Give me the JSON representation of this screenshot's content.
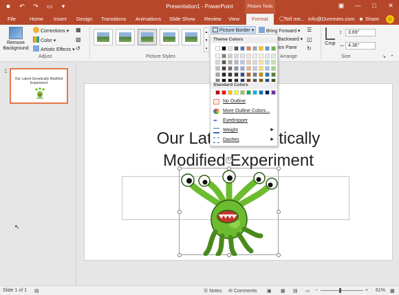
{
  "window": {
    "title": "Presentation1 - PowerPoint",
    "context_label": "Picture Tools"
  },
  "tabs": [
    "File",
    "Home",
    "Insert",
    "Design",
    "Transitions",
    "Animations",
    "Slide Show",
    "Review",
    "View",
    "Format"
  ],
  "active_tab": "Format",
  "tell_me": "Tell me...",
  "user": "info@Dummies.com",
  "share": "Share",
  "ribbon": {
    "remove_background": "Remove Background",
    "corrections": "Corrections",
    "color": "Color",
    "artistic_effects": "Artistic Effects",
    "adjust_label": "Adjust",
    "picture_styles_label": "Picture Styles",
    "picture_border": "Picture Border",
    "bring_forward": "Bring Forward",
    "backward": "Backward",
    "selection_pane": "ion Pane",
    "arrange_label": "Arrange",
    "crop": "Crop",
    "height": "3.69\"",
    "width": "4.36\"",
    "size_label": "Size"
  },
  "menu": {
    "theme_colors_label": "Theme Colors",
    "standard_colors_label": "Standard Colors",
    "theme_colors": [
      [
        "#ffffff",
        "#000000",
        "#e7e6e6",
        "#44546a",
        "#4472c4",
        "#ed7d31",
        "#a5a5a5",
        "#ffc000",
        "#5b9bd5",
        "#70ad47"
      ],
      [
        "#f2f2f2",
        "#7f7f7f",
        "#d0cece",
        "#d6dce4",
        "#d9e2f3",
        "#fbe4d5",
        "#ededed",
        "#fff2cc",
        "#deebf6",
        "#e2efd9"
      ],
      [
        "#d8d8d8",
        "#595959",
        "#aeabab",
        "#adb9ca",
        "#b4c6e7",
        "#f7caac",
        "#dbdbdb",
        "#fee599",
        "#bdd7ee",
        "#c5e0b3"
      ],
      [
        "#bfbfbf",
        "#3f3f3f",
        "#757070",
        "#8496b0",
        "#8eaadb",
        "#f4b183",
        "#c9c9c9",
        "#ffd965",
        "#9cc3e5",
        "#a8d08d"
      ],
      [
        "#a5a5a5",
        "#262626",
        "#3a3838",
        "#323f4f",
        "#2f5496",
        "#c55a11",
        "#7b7b7b",
        "#bf8f00",
        "#2e75b5",
        "#538135"
      ],
      [
        "#7f7f7f",
        "#0c0c0c",
        "#171616",
        "#222a35",
        "#1f3864",
        "#833c0b",
        "#525252",
        "#7f6000",
        "#1e4e79",
        "#375623"
      ]
    ],
    "standard_colors": [
      "#c00000",
      "#ff0000",
      "#ffc000",
      "#ffff00",
      "#92d050",
      "#00b050",
      "#00b0f0",
      "#0070c0",
      "#002060",
      "#7030a0"
    ],
    "no_outline": "No Outline",
    "more_colors": "More Outline Colors...",
    "eyedropper": "Eyedropper",
    "weight": "Weight",
    "dashes": "Dashes"
  },
  "slide_panel": {
    "slide_number": "1",
    "thumb_title": "Our Latest Genetically Modified Experiment"
  },
  "slide": {
    "title_line1": "Our Latest Genetically",
    "title_line2": "Modified Experiment"
  },
  "status": {
    "slide_of": "Slide 1 of 1",
    "notes": "Notes",
    "comments": "Comments",
    "zoom": "61%"
  },
  "colors": {
    "accent": "#b7472a",
    "monster_green": "#6dbb2f"
  }
}
